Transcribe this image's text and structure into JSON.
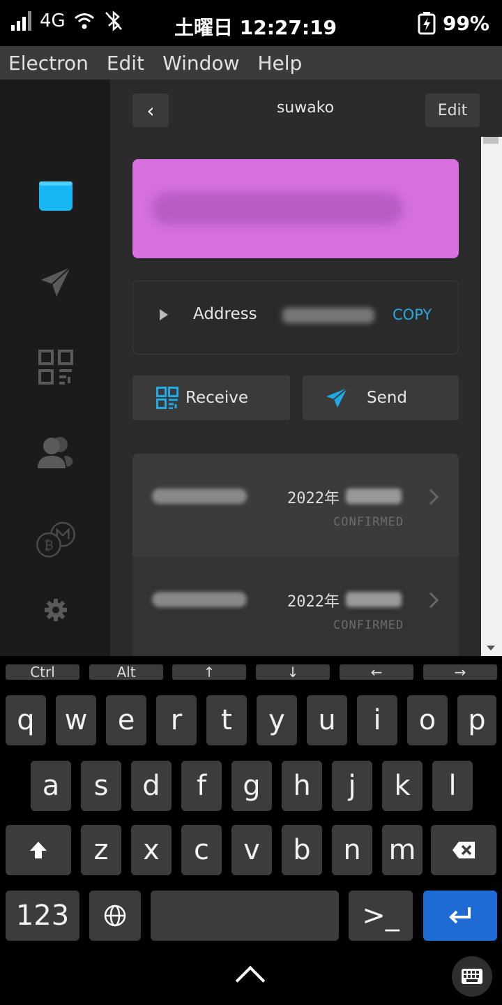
{
  "status_bar": {
    "network": "4G",
    "time": "土曜日 12:27:19",
    "battery": "99%"
  },
  "menu": [
    "Electron",
    "Edit",
    "Window",
    "Help"
  ],
  "header": {
    "back_glyph": "‹",
    "title": "suwako",
    "edit_label": "Edit"
  },
  "wallet": {
    "card_color": "#d66fe0",
    "address_label": "Address",
    "copy_label": "COPY",
    "receive_label": "Receive",
    "send_label": "Send",
    "accent": "#2aa7e0"
  },
  "transactions": [
    {
      "date": "2022年",
      "status": "CONFIRMED"
    },
    {
      "date": "2022年",
      "status": "CONFIRMED"
    }
  ],
  "sidebar_icons": [
    "wallet-icon",
    "send-icon",
    "qr-icon",
    "contacts-icon",
    "coins-icon",
    "settings-icon"
  ],
  "keyboard": {
    "function_keys": [
      "Ctrl",
      "Alt",
      "↑",
      "↓",
      "←",
      "→"
    ],
    "row1": [
      "q",
      "w",
      "e",
      "r",
      "t",
      "y",
      "u",
      "i",
      "o",
      "p"
    ],
    "row2": [
      "a",
      "s",
      "d",
      "f",
      "g",
      "h",
      "j",
      "k",
      "l"
    ],
    "row3": [
      "z",
      "x",
      "c",
      "v",
      "b",
      "n",
      "m"
    ],
    "numbers_label": "123",
    "terminal_label": ">_",
    "enter_color": "#1e6bd6"
  }
}
